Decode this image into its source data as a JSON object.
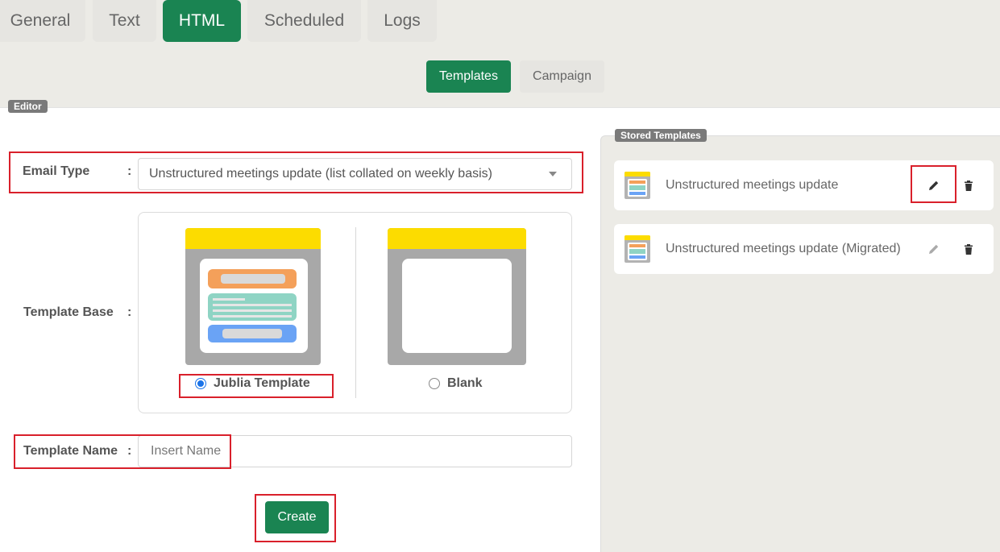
{
  "tabs": [
    {
      "label": "General",
      "active": false
    },
    {
      "label": "Text",
      "active": false
    },
    {
      "label": "HTML",
      "active": true
    },
    {
      "label": "Scheduled",
      "active": false
    },
    {
      "label": "Logs",
      "active": false
    }
  ],
  "subtabs": [
    {
      "label": "Templates",
      "active": true
    },
    {
      "label": "Campaign",
      "active": false
    }
  ],
  "editor": {
    "legend": "Editor",
    "email_type_label": "Email Type",
    "colon": ":",
    "email_type_value": "Unstructured meetings update (list collated on weekly basis)",
    "template_base_label": "Template Base",
    "options": [
      {
        "label": "Jublia Template",
        "selected": true
      },
      {
        "label": "Blank",
        "selected": false
      }
    ],
    "template_name_label": "Template Name",
    "template_name_placeholder": "Insert Name",
    "create_label": "Create"
  },
  "stored": {
    "legend": "Stored Templates",
    "items": [
      {
        "name": "Unstructured meetings update"
      },
      {
        "name": "Unstructured meetings update (Migrated)"
      }
    ]
  },
  "colors": {
    "accent": "#1a8452",
    "highlight": "#d9202b",
    "thumb_header": "#fcdc00"
  }
}
